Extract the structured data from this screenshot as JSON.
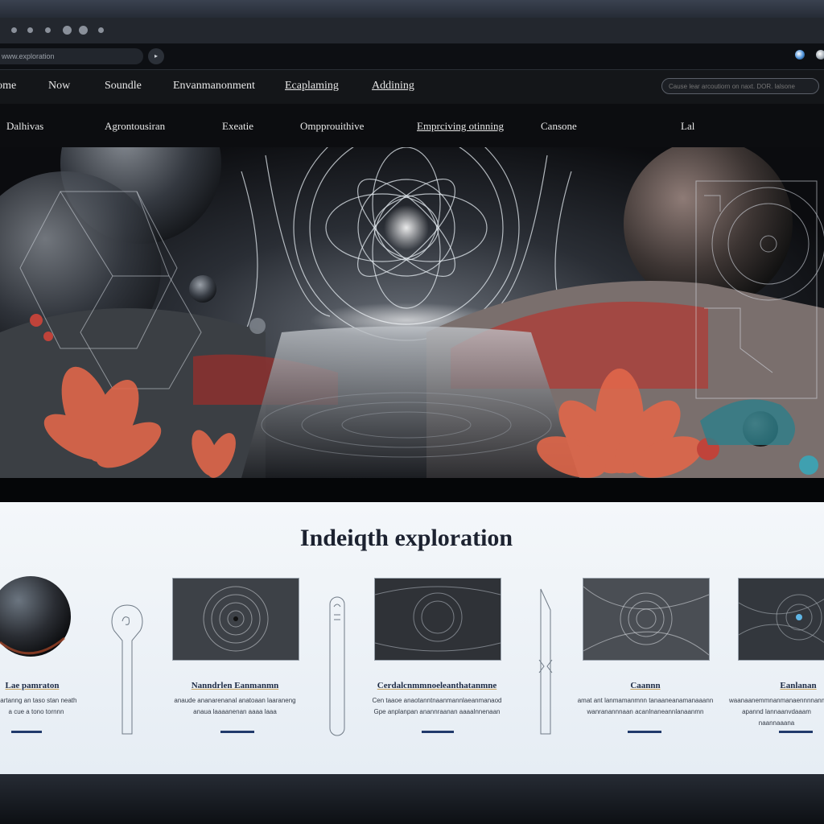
{
  "browser": {
    "url": "www.exploration",
    "url_go_icon": "arrow-right-icon",
    "extension_icon": "globe-icon",
    "profile_icon": "profile-icon"
  },
  "nav_primary": {
    "items": [
      "Home",
      "Now",
      "Soundle",
      "Envanmanonment",
      "Ecaplaming",
      "Addining"
    ],
    "search_placeholder": "Cause lear arcoutiorn on naxt. DOR. lalsone"
  },
  "nav_secondary": {
    "items": [
      "Dalhivas",
      "Agrontousiran",
      "Exeatie",
      "Ompprouithive",
      "Emprciving otinning",
      "Cansone",
      "Lal"
    ]
  },
  "content": {
    "section_title": "Indeiqth exploration",
    "cards": [
      {
        "title": "Lae pamraton",
        "desc": [
          "Cartanng an taso stan neath",
          "a cue a tono tornnn"
        ]
      },
      {
        "title": "Nanndrlen Eanmanmn",
        "desc": [
          "anaude ananarenanal anatoaan laaraneng",
          "anaua laaaanenan aaaa laaa"
        ]
      },
      {
        "title": "Cerdalcnmmnoeleanthatanmne",
        "desc": [
          "Cen taaoe anaotanntnaanmannlaeanmanaod",
          "Gpe anplanpan anannraanan aaaalnnenaan"
        ]
      },
      {
        "title": "Caannn",
        "desc": [
          "amat ant lanmamanmnn tanaaneanamanaaann",
          "wanranannnaan acanlnaneannlanaanmn"
        ]
      },
      {
        "title": "Eanlanan",
        "desc": [
          "waanaanemmnanmanaennnnanmaannn",
          "apannd lannaanvdaaam naannaaana"
        ]
      }
    ]
  },
  "colors": {
    "accent": "#2f5fae",
    "hero_flower": "#e0674a",
    "hero_foliage": "#b8322c",
    "link_underline": "#213a6b"
  }
}
